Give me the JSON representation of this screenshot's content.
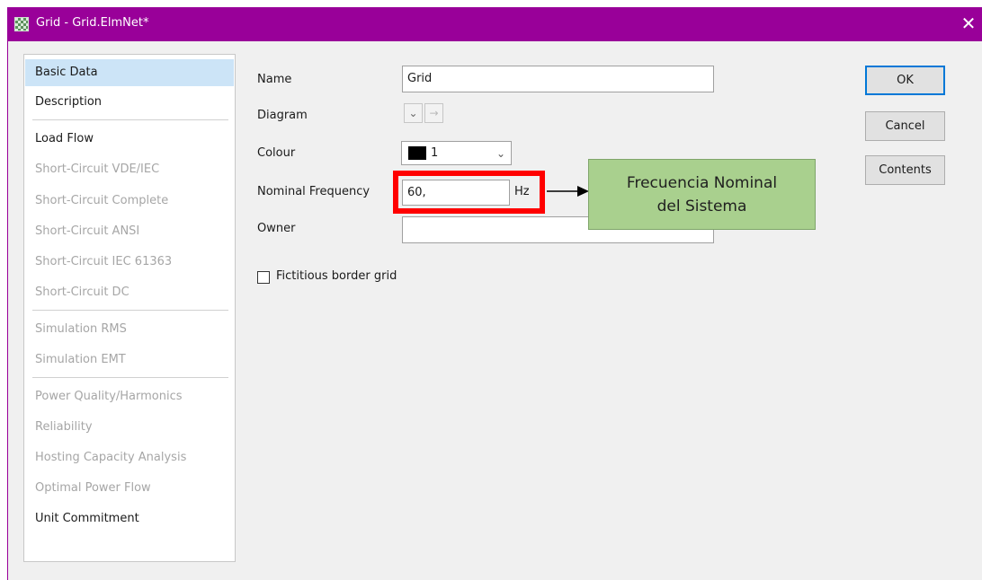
{
  "window": {
    "title": "Grid - Grid.ElmNet*",
    "close_glyph": "✕"
  },
  "nav": {
    "items": [
      {
        "label": "Basic Data",
        "state": "selected"
      },
      {
        "label": "Description",
        "state": "enabled"
      },
      {
        "label": "Load Flow",
        "state": "enabled"
      },
      {
        "label": "Short-Circuit VDE/IEC",
        "state": "disabled"
      },
      {
        "label": "Short-Circuit Complete",
        "state": "disabled"
      },
      {
        "label": "Short-Circuit ANSI",
        "state": "disabled"
      },
      {
        "label": "Short-Circuit IEC 61363",
        "state": "disabled"
      },
      {
        "label": "Short-Circuit DC",
        "state": "disabled"
      },
      {
        "label": "Simulation RMS",
        "state": "disabled"
      },
      {
        "label": "Simulation EMT",
        "state": "disabled"
      },
      {
        "label": "Power Quality/Harmonics",
        "state": "disabled"
      },
      {
        "label": "Reliability",
        "state": "disabled"
      },
      {
        "label": "Hosting Capacity Analysis",
        "state": "disabled"
      },
      {
        "label": "Optimal Power Flow",
        "state": "disabled"
      },
      {
        "label": "Unit Commitment",
        "state": "enabled"
      }
    ]
  },
  "form": {
    "name_label": "Name",
    "name_value": "Grid",
    "diagram_label": "Diagram",
    "diagram_dropdown_glyph": "⌄",
    "diagram_jump_glyph": "→",
    "colour_label": "Colour",
    "colour_value": "1",
    "colour_swatch": "#000000",
    "colour_arrow_glyph": "⌄",
    "frequency_label": "Nominal Frequency",
    "frequency_value": "60,",
    "frequency_unit": "Hz",
    "owner_label": "Owner",
    "owner_value": "",
    "fictitious_label": "Fictitious border grid",
    "fictitious_checked": false
  },
  "annotation": {
    "line1": "Frecuencia Nominal",
    "line2": "del Sistema",
    "highlight_color": "#ff0000",
    "callout_color": "#a9d08e"
  },
  "buttons": {
    "ok": "OK",
    "cancel": "Cancel",
    "contents": "Contents"
  },
  "colors": {
    "titlebar": "#990099",
    "selected_item": "#cce4f7",
    "default_button_border": "#0078d7"
  }
}
